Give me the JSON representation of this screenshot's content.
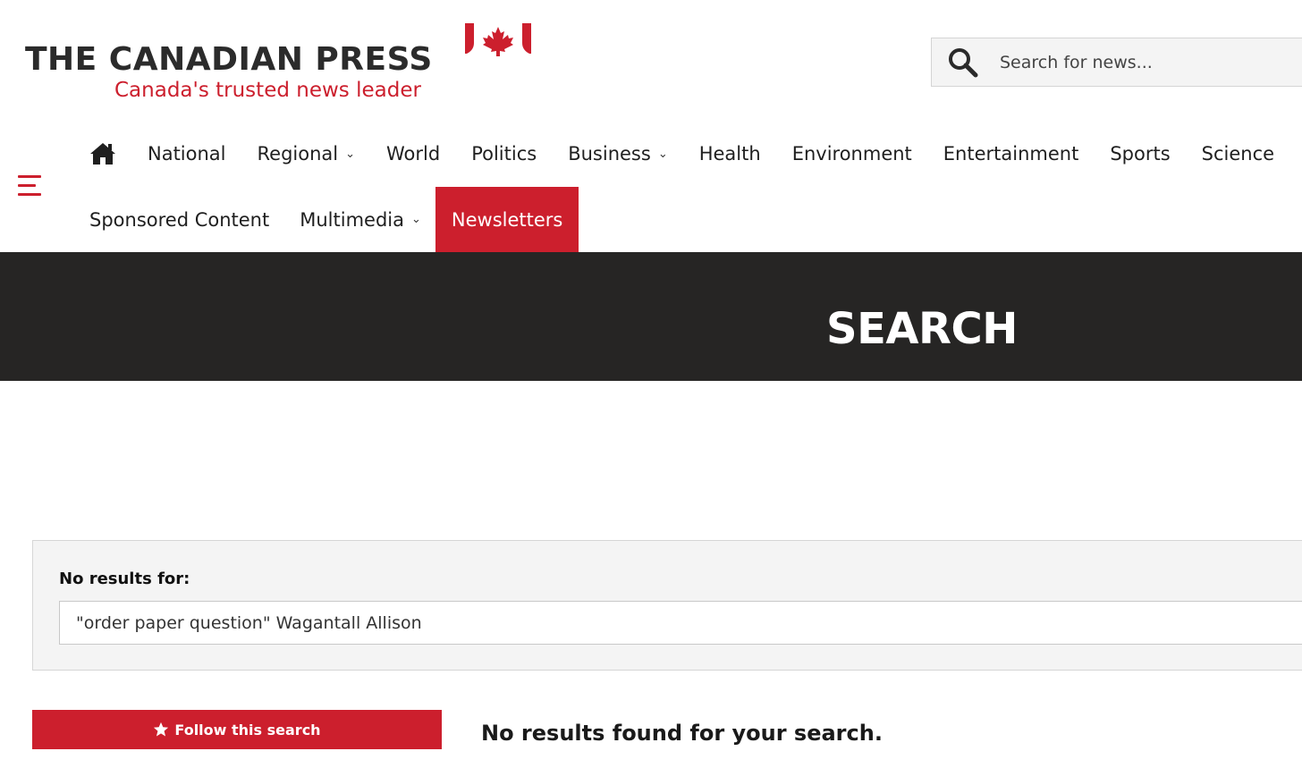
{
  "logo": {
    "title": "THE CANADIAN PRESS",
    "tagline": "Canada's trusted news leader"
  },
  "search": {
    "placeholder": "Search for news..."
  },
  "nav": {
    "row1": [
      {
        "label": "National",
        "dropdown": false
      },
      {
        "label": "Regional",
        "dropdown": true
      },
      {
        "label": "World",
        "dropdown": false
      },
      {
        "label": "Politics",
        "dropdown": false
      },
      {
        "label": "Business",
        "dropdown": true
      },
      {
        "label": "Health",
        "dropdown": false
      },
      {
        "label": "Environment",
        "dropdown": false
      },
      {
        "label": "Entertainment",
        "dropdown": false
      },
      {
        "label": "Sports",
        "dropdown": false
      },
      {
        "label": "Science",
        "dropdown": false
      }
    ],
    "row2": [
      {
        "label": "Sponsored Content",
        "dropdown": false
      },
      {
        "label": "Multimedia",
        "dropdown": true
      },
      {
        "label": "Newsletters",
        "dropdown": false,
        "active": true
      }
    ],
    "chevron": "⌄"
  },
  "banner": {
    "title": "SEARCH"
  },
  "results": {
    "label": "No results for:",
    "query": "\"order paper question\" Wagantall Allison"
  },
  "follow": {
    "label": "Follow this search"
  },
  "message": {
    "no_results": "No results found for your search."
  },
  "colors": {
    "brand_red": "#cc1f2d",
    "banner_bg": "#262524",
    "panel_bg": "#f4f4f4"
  },
  "icons": {
    "home": "home-icon",
    "search": "search-icon",
    "menu": "hamburger-menu-icon",
    "star": "star-icon",
    "flag": "canada-flag-icon"
  }
}
